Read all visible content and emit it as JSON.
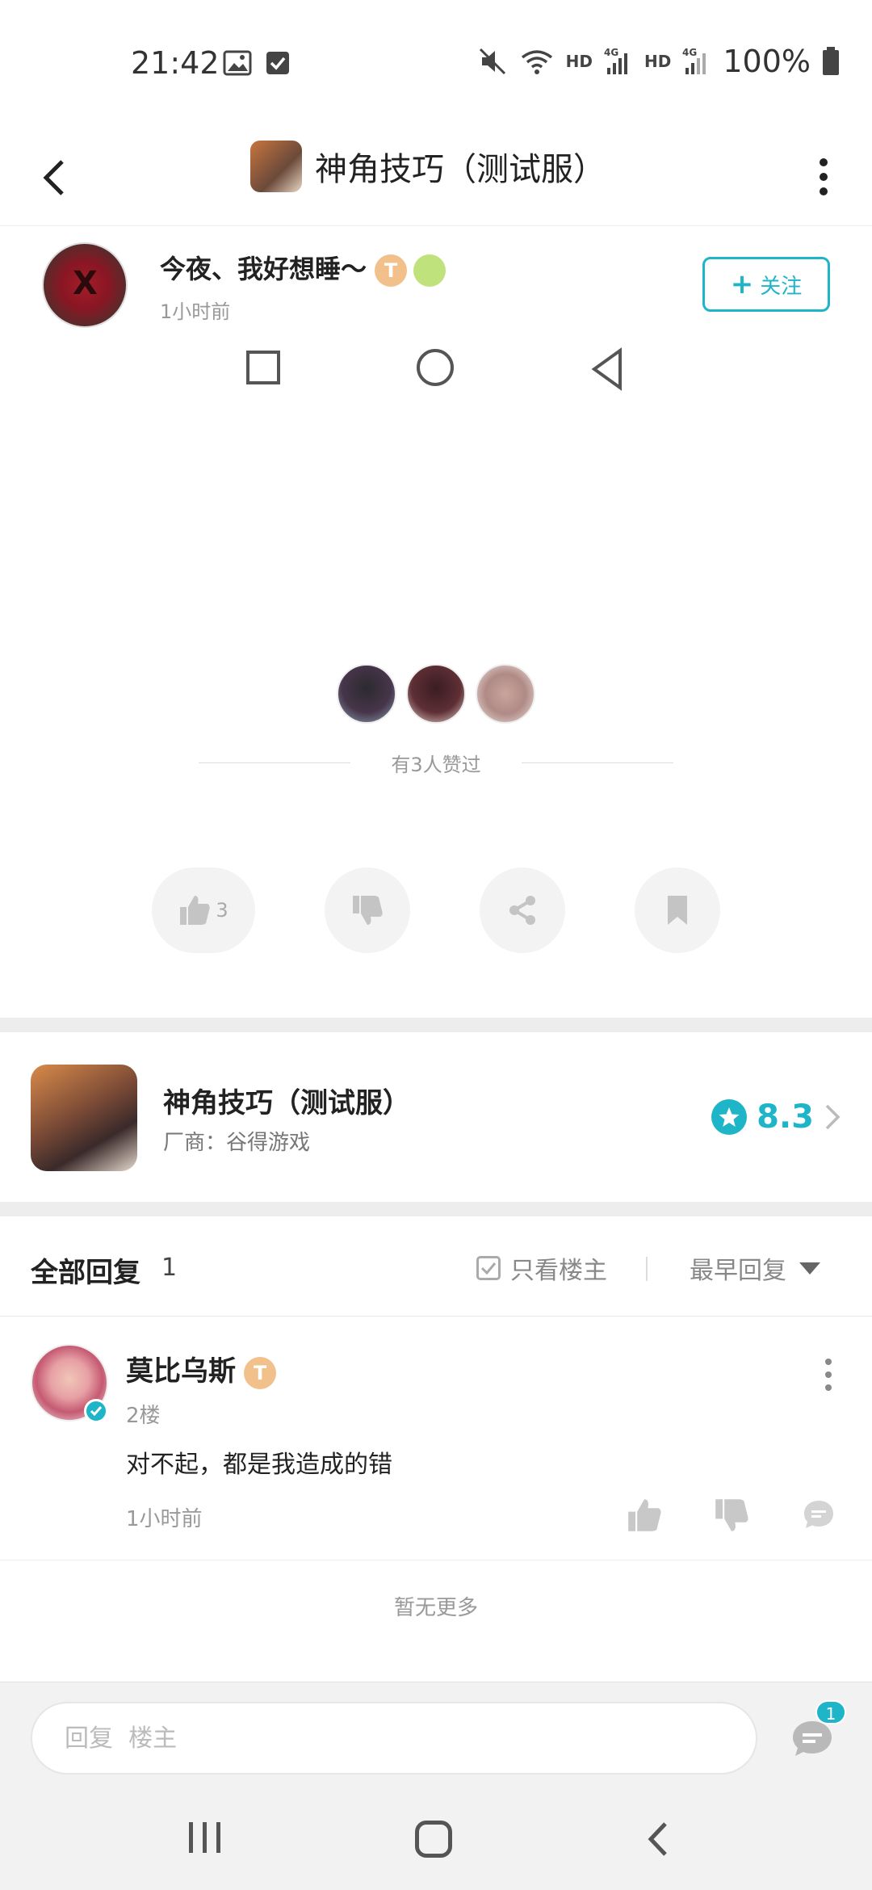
{
  "status_bar": {
    "time": "21:42",
    "battery": "100%",
    "network_label_1": "HD",
    "network_label_2": "HD",
    "icons": [
      "image-icon",
      "check-square-icon",
      "mute-icon",
      "wifi-icon",
      "signal-4g-icon",
      "signal-4g-icon",
      "battery-icon"
    ]
  },
  "header": {
    "title": "神角技巧（测试服）"
  },
  "post": {
    "author_name": "今夜、我好想睡～",
    "author_badge": "T",
    "time": "1小时前",
    "follow_label": "关注",
    "likers_text": "有3人赞过",
    "like_count": "3"
  },
  "game_card": {
    "title": "神角技巧（测试服）",
    "vendor": "厂商：谷得游戏",
    "rating": "8.3"
  },
  "replies": {
    "title": "全部回复",
    "count": "1",
    "filter_label": "只看楼主",
    "sort_label": "最早回复",
    "items": [
      {
        "name": "莫比乌斯",
        "badge": "T",
        "floor": "2楼",
        "text": "对不起，都是我造成的错",
        "time": "1小时前"
      }
    ],
    "no_more": "暂无更多"
  },
  "reply_bar": {
    "placeholder": "回复  楼主",
    "comment_badge": "1"
  },
  "colors": {
    "accent": "#1fb5c8",
    "band": "#ededed"
  }
}
